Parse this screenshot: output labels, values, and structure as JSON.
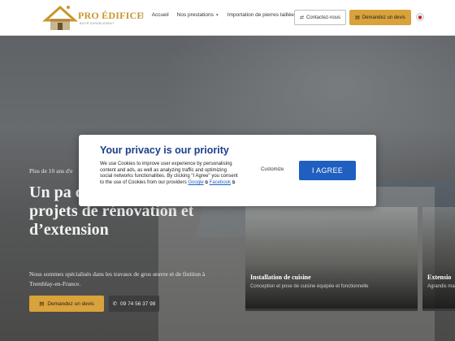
{
  "header": {
    "logo": {
      "name": "PRO ÉDIFICE",
      "tagline": "BATIR DURABLEMENT"
    },
    "nav": [
      {
        "label": "Accueil"
      },
      {
        "label": "Nos prestations"
      },
      {
        "label": "Importation de pierres taillées"
      }
    ],
    "contact_label": "Contactez-nous",
    "devis_label": "Demandez un devis",
    "language": "fr"
  },
  "hero": {
    "kicker": "Plus de 10 ans d'e",
    "title": "Un pa confiance pour les projets de rénovation et d’extension",
    "description": "Nous sommes spécialisés dans les travaux de gros œuvre et de finition à Tremblay-en-France.",
    "devis_label": "Demandez un devis",
    "phone": "09 74 56 37 98"
  },
  "services": [
    {
      "title": "Installation de cuisine",
      "text": "Conception et pose de cuisine équipée et fonctionnelle"
    },
    {
      "title": "Extensio",
      "text": "Agrandis maçonne"
    }
  ],
  "cookie": {
    "title": "Your privacy is our priority",
    "body": "We use Cookies to improve user experience by personalising content and ads, as well as analyzing traffic and optimizing social networks functionalities. By clicking \"I Agree\" you consent to the use of Cookies from our providers",
    "link_google": "Google",
    "link_facebook": "Facebook",
    "customize_label": "Customize",
    "agree_label": "I AGREE"
  },
  "colors": {
    "brand_gold": "#d9a23a",
    "cookie_title": "#1b3f8a",
    "agree_button": "#1e5fbf"
  }
}
